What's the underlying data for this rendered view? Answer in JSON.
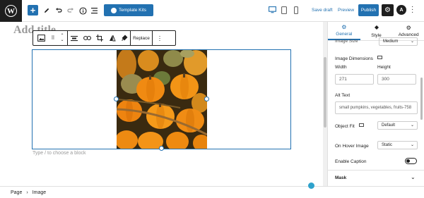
{
  "toolbar": {
    "wp_logo": "W",
    "add_icon": "plus-icon",
    "template_kits_label": "Template Kits",
    "save_draft_label": "Save draft",
    "preview_label": "Preview",
    "publish_label": "Publish"
  },
  "editor": {
    "title_placeholder": "Add title",
    "block_toolbar": {
      "replace_label": "Replace"
    },
    "type_hint": "Type / to choose a block"
  },
  "sidebar": {
    "tabs": [
      {
        "label": "General",
        "icon": "gear-icon",
        "active": true
      },
      {
        "label": "Style",
        "icon": "paint-bucket-icon",
        "active": false
      },
      {
        "label": "Advanced",
        "icon": "gear-icon",
        "active": false
      }
    ],
    "image_size_label": "Image Size",
    "image_size_value": "Medium",
    "image_dimensions_label": "Image Dimensions",
    "width_label": "Width",
    "height_label": "Height",
    "width_value": "271",
    "height_value": "300",
    "alt_text_label": "Alt Text",
    "alt_text_value": "small pumpkins, vegetables, fruits-758",
    "object_fit_label": "Object Fit",
    "object_fit_value": "Default",
    "on_hover_label": "On Hover Image",
    "on_hover_value": "Static",
    "enable_caption_label": "Enable Caption",
    "enable_caption_on": false,
    "mask_label": "Mask"
  },
  "breadcrumb": {
    "items": [
      "Page",
      "Image"
    ]
  },
  "colors": {
    "accent": "#2271b1",
    "dark": "#1e1e1e"
  }
}
